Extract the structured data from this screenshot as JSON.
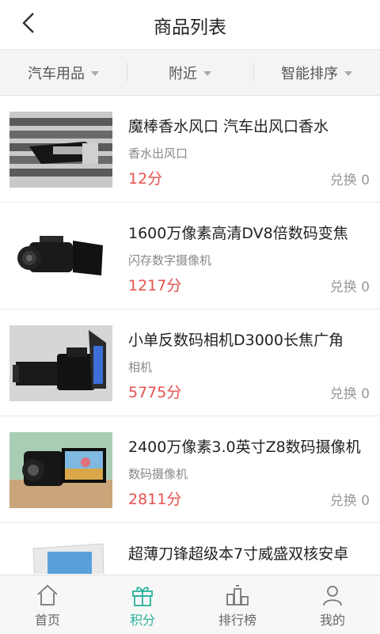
{
  "header": {
    "title": "商品列表"
  },
  "filters": [
    {
      "label": "汽车用品"
    },
    {
      "label": "附近"
    },
    {
      "label": "智能排序"
    }
  ],
  "products": [
    {
      "name": "魔棒香水风口 汽车出风口香水",
      "category": "香水出风口",
      "price": "12分",
      "redeem": "兑换 0"
    },
    {
      "name": "1600万像素高清DV8倍数码变焦",
      "category": "闪存数字摄像机",
      "price": "1217分",
      "redeem": "兑换 0"
    },
    {
      "name": "小单反数码相机D3000长焦广角",
      "category": "相机",
      "price": "5775分",
      "redeem": "兑换 0"
    },
    {
      "name": "2400万像素3.0英寸Z8数码摄像机",
      "category": "数码摄像机",
      "price": "2811分",
      "redeem": "兑换 0"
    },
    {
      "name": "超薄刀锋超级本7寸威盛双核安卓",
      "category": "",
      "price": "",
      "redeem": ""
    }
  ],
  "tabbar": {
    "items": [
      {
        "label": "首页",
        "icon": "home-icon"
      },
      {
        "label": "积分",
        "icon": "gift-icon",
        "active": true
      },
      {
        "label": "排行榜",
        "icon": "ranking-icon"
      },
      {
        "label": "我的",
        "icon": "profile-icon"
      }
    ],
    "active_color": "#29b19a",
    "price_color": "#e5514e"
  }
}
